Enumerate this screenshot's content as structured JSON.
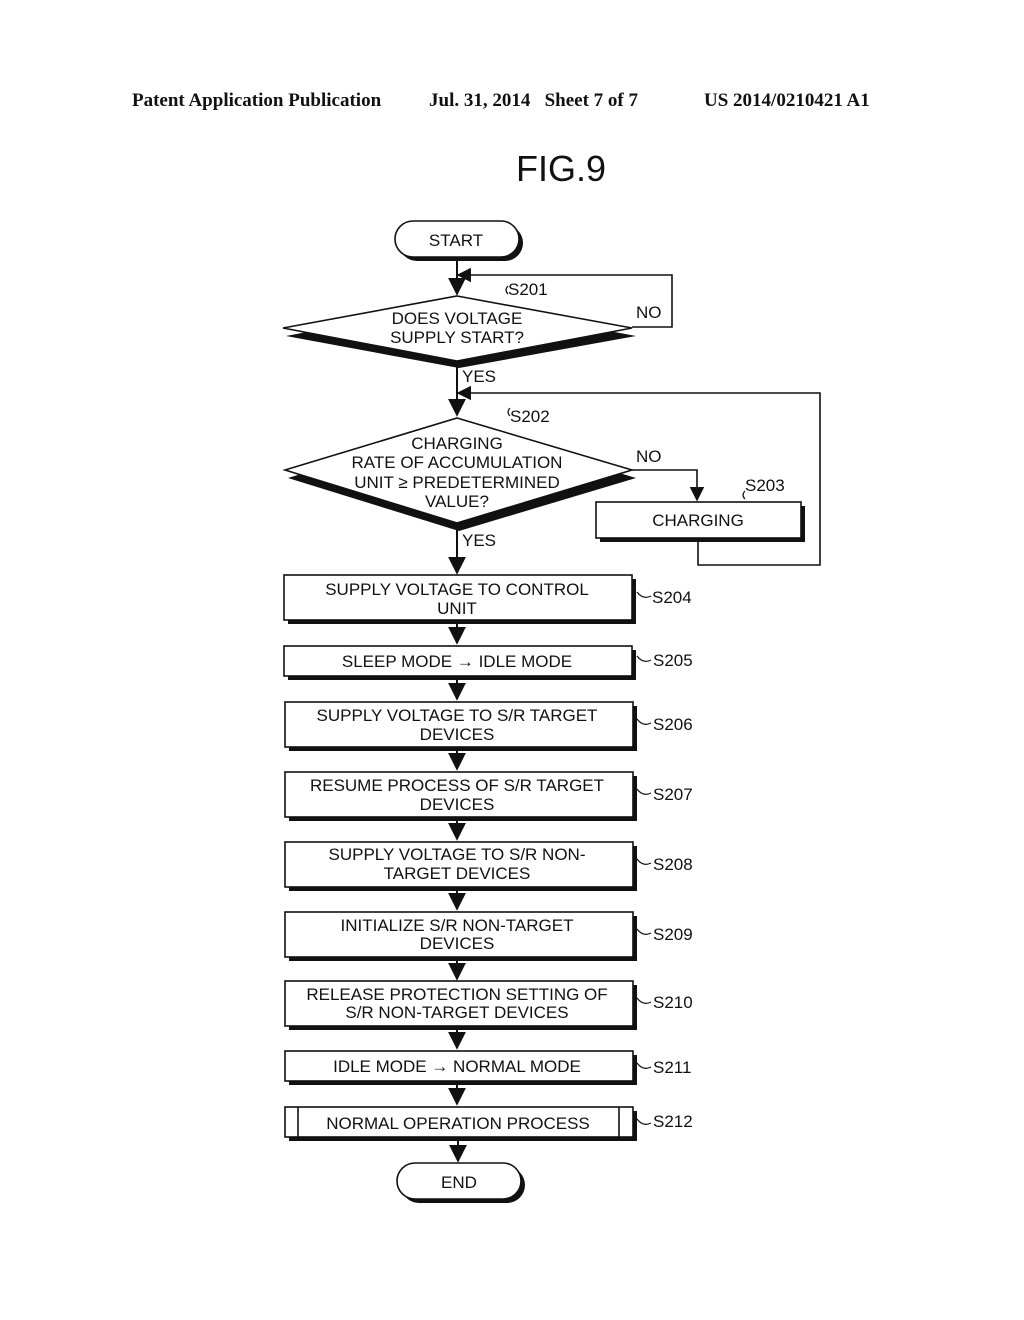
{
  "header": {
    "publication": "Patent Application Publication",
    "date_sheet": "Jul. 31, 2014   Sheet 7 of 7",
    "number": "US 2014/0210421 A1"
  },
  "figure": {
    "title": "FIG.9"
  },
  "flow": {
    "start": "START",
    "end": "END",
    "s201": {
      "id": "S201",
      "lines": [
        "DOES VOLTAGE",
        "SUPPLY START?"
      ],
      "no": "NO",
      "yes": "YES"
    },
    "s202": {
      "id": "S202",
      "lines": [
        "CHARGING",
        "RATE OF ACCUMULATION",
        "UNIT ≥ PREDETERMINED",
        "VALUE?"
      ],
      "no": "NO",
      "yes": "YES"
    },
    "s203": {
      "id": "S203",
      "lines": [
        "CHARGING"
      ]
    },
    "s204": {
      "id": "S204",
      "lines": [
        "SUPPLY VOLTAGE TO CONTROL",
        "UNIT"
      ]
    },
    "s205": {
      "id": "S205",
      "lines": [
        "SLEEP MODE → IDLE MODE"
      ]
    },
    "s206": {
      "id": "S206",
      "lines": [
        "SUPPLY VOLTAGE TO S/R TARGET",
        "DEVICES"
      ]
    },
    "s207": {
      "id": "S207",
      "lines": [
        "RESUME PROCESS OF S/R TARGET",
        "DEVICES"
      ]
    },
    "s208": {
      "id": "S208",
      "lines": [
        "SUPPLY VOLTAGE TO S/R NON-",
        "TARGET DEVICES"
      ]
    },
    "s209": {
      "id": "S209",
      "lines": [
        "INITIALIZE S/R NON-TARGET",
        "DEVICES"
      ]
    },
    "s210": {
      "id": "S210",
      "lines": [
        "RELEASE PROTECTION SETTING OF",
        "S/R NON-TARGET DEVICES"
      ]
    },
    "s211": {
      "id": "S211",
      "lines": [
        "IDLE MODE → NORMAL MODE"
      ]
    },
    "s212": {
      "id": "S212",
      "lines": [
        "NORMAL OPERATION PROCESS"
      ]
    }
  }
}
